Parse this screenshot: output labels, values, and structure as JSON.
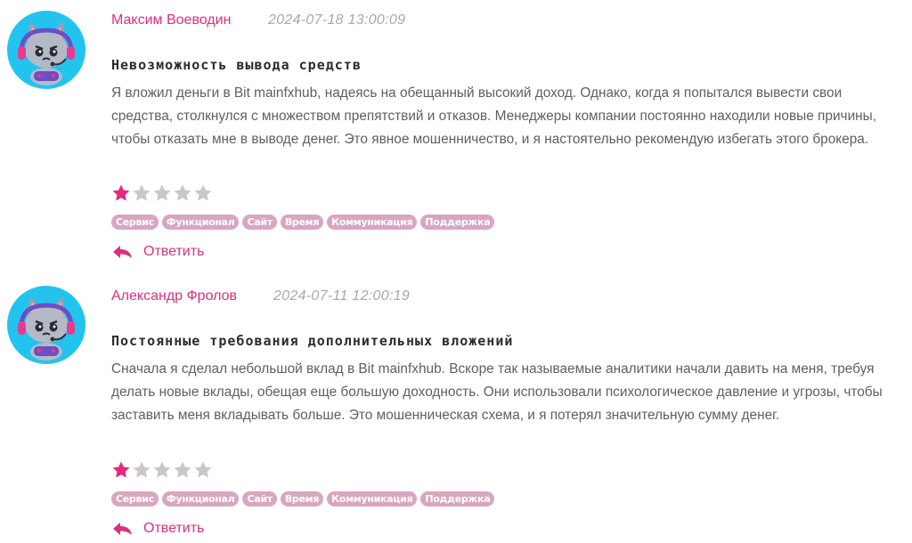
{
  "reviews": [
    {
      "author": "Максим Воеводин",
      "date": "2024-07-18 13:00:09",
      "title": "Невозможность вывода средств",
      "text": "Я вложил деньги в Bit mainfxhub, надеясь на обещанный высокий доход. Однако, когда я попытался вывести свои средства, столкнулся с множеством препятствий и отказов. Менеджеры компании постоянно находили новые причины, чтобы отказать мне в выводе денег. Это явное мошенничество, и я настоятельно рекомендую избегать этого брокера.",
      "rating": 1,
      "rating_max": 5,
      "tags": [
        "Сервис",
        "Функционал",
        "Сайт",
        "Время",
        "Коммуникация",
        "Поддержка"
      ],
      "reply_label": "Ответить"
    },
    {
      "author": "Александр Фролов",
      "date": "2024-07-11 12:00:19",
      "title": "Постоянные требования дополнительных вложений",
      "text": "Сначала я сделал небольшой вклад в Bit mainfxhub. Вскоре так называемые аналитики начали давить на меня, требуя делать новые вклады, обещая еще большую доходность. Они использовали психологическое давление и угрозы, чтобы заставить меня вкладывать больше. Это мошенническая схема, и я потерял значительную сумму денег.",
      "rating": 1,
      "rating_max": 5,
      "tags": [
        "Сервис",
        "Функционал",
        "Сайт",
        "Время",
        "Коммуникация",
        "Поддержка"
      ],
      "reply_label": "Ответить"
    }
  ],
  "colors": {
    "accent": "#d9307f",
    "star_filled": "#e8297e",
    "star_empty": "#c8c8c8",
    "tag_bg": "#d9a6c0",
    "avatar_bg": "#22c4ee"
  }
}
